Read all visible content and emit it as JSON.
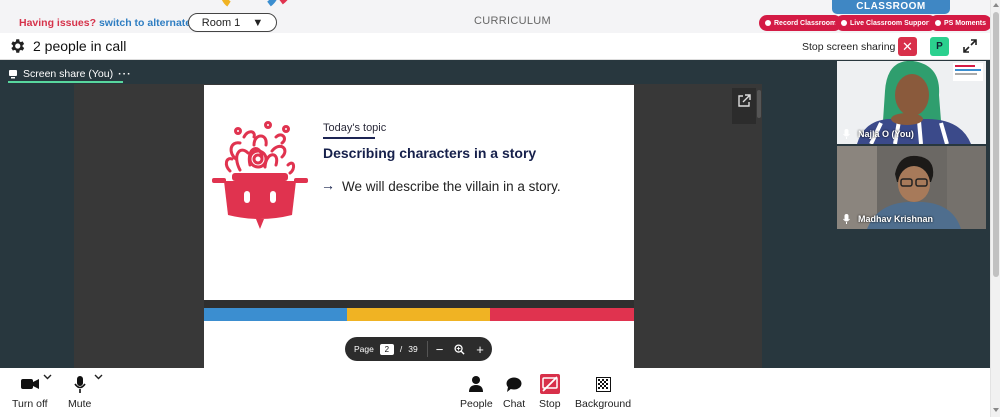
{
  "topbar": {
    "issue_prefix": "Having issues?",
    "issue_link": "switch to alternate room",
    "room_select": "Room 1",
    "curriculum": "CURRICULUM",
    "classroom": "CLASSROOM",
    "pills": [
      "Record Classroom",
      "Live Classroom Support",
      "PS Moments"
    ]
  },
  "callbar": {
    "title": "2 people in call",
    "stop_sharing_label": "Stop screen sharing",
    "avatar_initial": "P"
  },
  "stage": {
    "share_tab_label": "Screen share (You)",
    "share_tab_menu": "···"
  },
  "slide": {
    "topic_label": "Today's topic",
    "title": "Describing characters in a story",
    "arrow": "→",
    "text": "We will describe the villain in a story."
  },
  "pager": {
    "label": "Page",
    "current": "2",
    "slash": "/",
    "total": "39",
    "zoom_out": "−",
    "zoom_in": "+"
  },
  "participants": [
    {
      "name": "Najla O (You)"
    },
    {
      "name": "Madhav Krishnan"
    }
  ],
  "toolbar": {
    "camera": "Turn off",
    "mute": "Mute",
    "people": "People",
    "chat": "Chat",
    "stop": "Stop",
    "background": "Background"
  },
  "colors": {
    "accent_red": "#d41b45",
    "link_blue": "#2f7ec2",
    "brand_navy": "#16204b",
    "stripe_blue": "#3b8ed0",
    "stripe_yellow": "#f0b323",
    "stripe_pink": "#e0334f",
    "share_green": "#58d79e"
  }
}
